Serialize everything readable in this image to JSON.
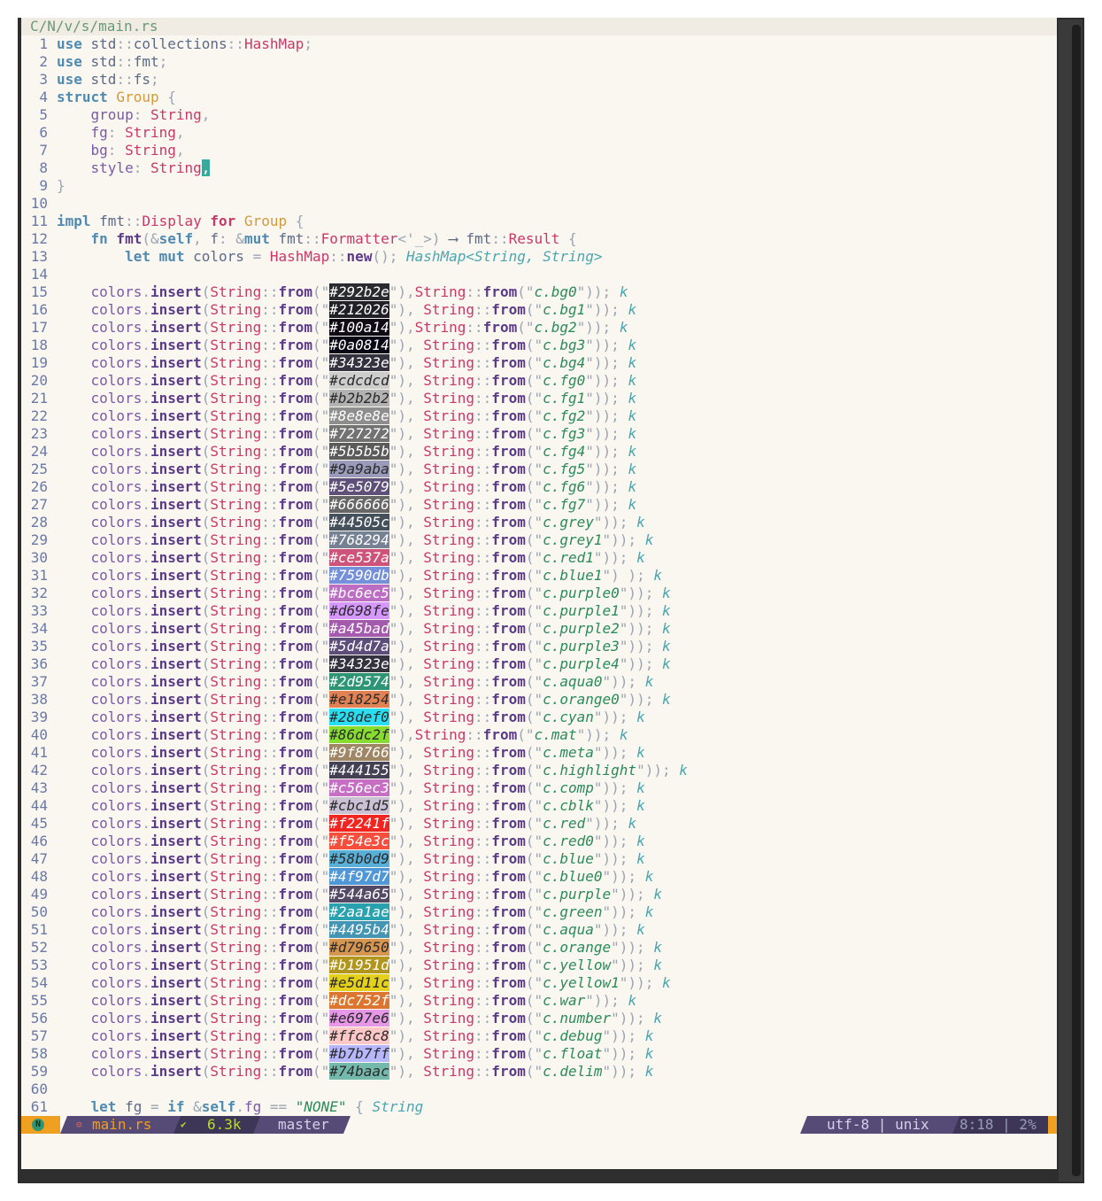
{
  "file_path": "C/N/v/s/main.rs",
  "colors": {
    "editor_bg": "#faf7f0",
    "status_bg": "#564a76",
    "status_fg": "#d8d0e8",
    "status_accent": "#f0a020"
  },
  "code_lines": [
    {
      "n": "1"
    },
    {
      "n": "2"
    },
    {
      "n": "3"
    },
    {
      "n": "4"
    },
    {
      "n": "5"
    },
    {
      "n": "6"
    },
    {
      "n": "7"
    },
    {
      "n": "8"
    },
    {
      "n": "9"
    },
    {
      "n": "10"
    },
    {
      "n": "11"
    },
    {
      "n": "12"
    },
    {
      "n": "13"
    },
    {
      "n": "14"
    }
  ],
  "header_code": [
    [
      [
        "kw",
        "use"
      ],
      [
        "id",
        " std"
      ],
      [
        "pc",
        "::"
      ],
      [
        "id",
        "collections"
      ],
      [
        "pc",
        "::"
      ],
      [
        "ty",
        "HashMap"
      ],
      [
        "pc",
        ";"
      ]
    ],
    [
      [
        "kw",
        "use"
      ],
      [
        "id",
        " std"
      ],
      [
        "pc",
        "::"
      ],
      [
        "id",
        "fmt"
      ],
      [
        "pc",
        ";"
      ]
    ],
    [
      [
        "kw",
        "use"
      ],
      [
        "id",
        " std"
      ],
      [
        "pc",
        "::"
      ],
      [
        "id",
        "fs"
      ],
      [
        "pc",
        ";"
      ]
    ],
    [
      [
        "kw",
        "struct"
      ],
      [
        "ty2",
        " Group"
      ],
      [
        "pc",
        " {"
      ]
    ],
    [
      [
        "fld",
        "    group"
      ],
      [
        "pc",
        ": "
      ],
      [
        "ty",
        "String"
      ],
      [
        "pc",
        ","
      ]
    ],
    [
      [
        "fld",
        "    fg"
      ],
      [
        "pc",
        ": "
      ],
      [
        "ty",
        "String"
      ],
      [
        "pc",
        ","
      ]
    ],
    [
      [
        "fld",
        "    bg"
      ],
      [
        "pc",
        ": "
      ],
      [
        "ty",
        "String"
      ],
      [
        "pc",
        ","
      ]
    ],
    [
      [
        "fld",
        "    style"
      ],
      [
        "pc",
        ": "
      ],
      [
        "ty",
        "String"
      ],
      [
        "cursor",
        ","
      ]
    ],
    [
      [
        "pc",
        "}"
      ]
    ],
    [],
    [
      [
        "kw",
        "impl"
      ],
      [
        "id",
        " fmt"
      ],
      [
        "pc",
        "::"
      ],
      [
        "ty",
        "Display"
      ],
      [
        "kw2",
        " for"
      ],
      [
        "ty2",
        " Group"
      ],
      [
        "pc",
        " {"
      ]
    ],
    [
      [
        "kw",
        "    fn"
      ],
      [
        "fn",
        " fmt"
      ],
      [
        "pc",
        "(&"
      ],
      [
        "kw",
        "self"
      ],
      [
        "pc",
        ", "
      ],
      [
        "id",
        "f"
      ],
      [
        "pc",
        ": &"
      ],
      [
        "kw",
        "mut"
      ],
      [
        "id",
        " fmt"
      ],
      [
        "pc",
        "::"
      ],
      [
        "ty",
        "Formatter"
      ],
      [
        "pc",
        "<'_>) "
      ],
      [
        "id",
        "⟶ "
      ],
      [
        "id",
        "fmt"
      ],
      [
        "pc",
        "::"
      ],
      [
        "ty",
        "Result"
      ],
      [
        "pc",
        " {"
      ]
    ],
    [
      [
        "kw",
        "        let mut"
      ],
      [
        "id",
        " colors"
      ],
      [
        "pc",
        " = "
      ],
      [
        "ty",
        "HashMap"
      ],
      [
        "pc",
        "::"
      ],
      [
        "fn",
        "new"
      ],
      [
        "pc",
        "(); "
      ],
      [
        "cm",
        "HashMap<String, String>"
      ]
    ],
    []
  ],
  "color_entries": [
    {
      "n": "15",
      "hex": "#292b2e",
      "name": "c.bg0",
      "tight": true
    },
    {
      "n": "16",
      "hex": "#212026",
      "name": "c.bg1"
    },
    {
      "n": "17",
      "hex": "#100a14",
      "name": "c.bg2",
      "tight": true
    },
    {
      "n": "18",
      "hex": "#0a0814",
      "name": "c.bg3"
    },
    {
      "n": "19",
      "hex": "#34323e",
      "name": "c.bg4"
    },
    {
      "n": "20",
      "hex": "#cdcdcd",
      "name": "c.fg0"
    },
    {
      "n": "21",
      "hex": "#b2b2b2",
      "name": "c.fg1"
    },
    {
      "n": "22",
      "hex": "#8e8e8e",
      "name": "c.fg2"
    },
    {
      "n": "23",
      "hex": "#727272",
      "name": "c.fg3"
    },
    {
      "n": "24",
      "hex": "#5b5b5b",
      "name": "c.fg4"
    },
    {
      "n": "25",
      "hex": "#9a9aba",
      "name": "c.fg5"
    },
    {
      "n": "26",
      "hex": "#5e5079",
      "name": "c.fg6"
    },
    {
      "n": "27",
      "hex": "#666666",
      "name": "c.fg7"
    },
    {
      "n": "28",
      "hex": "#44505c",
      "name": "c.grey"
    },
    {
      "n": "29",
      "hex": "#768294",
      "name": "c.grey1"
    },
    {
      "n": "30",
      "hex": "#ce537a",
      "name": "c.red1"
    },
    {
      "n": "31",
      "hex": "#7590db",
      "name": "c.blue1",
      "gap": true
    },
    {
      "n": "32",
      "hex": "#bc6ec5",
      "name": "c.purple0"
    },
    {
      "n": "33",
      "hex": "#d698fe",
      "name": "c.purple1"
    },
    {
      "n": "34",
      "hex": "#a45bad",
      "name": "c.purple2"
    },
    {
      "n": "35",
      "hex": "#5d4d7a",
      "name": "c.purple3"
    },
    {
      "n": "36",
      "hex": "#34323e",
      "name": "c.purple4"
    },
    {
      "n": "37",
      "hex": "#2d9574",
      "name": "c.aqua0"
    },
    {
      "n": "38",
      "hex": "#e18254",
      "name": "c.orange0"
    },
    {
      "n": "39",
      "hex": "#28def0",
      "name": "c.cyan"
    },
    {
      "n": "40",
      "hex": "#86dc2f",
      "name": "c.mat",
      "tight": true
    },
    {
      "n": "41",
      "hex": "#9f8766",
      "name": "c.meta"
    },
    {
      "n": "42",
      "hex": "#444155",
      "name": "c.highlight"
    },
    {
      "n": "43",
      "hex": "#c56ec3",
      "name": "c.comp"
    },
    {
      "n": "44",
      "hex": "#cbc1d5",
      "name": "c.cblk"
    },
    {
      "n": "45",
      "hex": "#f2241f",
      "name": "c.red"
    },
    {
      "n": "46",
      "hex": "#f54e3c",
      "name": "c.red0"
    },
    {
      "n": "47",
      "hex": "#58b0d9",
      "name": "c.blue"
    },
    {
      "n": "48",
      "hex": "#4f97d7",
      "name": "c.blue0"
    },
    {
      "n": "49",
      "hex": "#544a65",
      "name": "c.purple"
    },
    {
      "n": "50",
      "hex": "#2aa1ae",
      "name": "c.green"
    },
    {
      "n": "51",
      "hex": "#4495b4",
      "name": "c.aqua"
    },
    {
      "n": "52",
      "hex": "#d79650",
      "name": "c.orange"
    },
    {
      "n": "53",
      "hex": "#b1951d",
      "name": "c.yellow"
    },
    {
      "n": "54",
      "hex": "#e5d11c",
      "name": "c.yellow1"
    },
    {
      "n": "55",
      "hex": "#dc752f",
      "name": "c.war"
    },
    {
      "n": "56",
      "hex": "#e697e6",
      "name": "c.number"
    },
    {
      "n": "57",
      "hex": "#ffc8c8",
      "name": "c.debug"
    },
    {
      "n": "58",
      "hex": "#b7b7ff",
      "name": "c.float"
    },
    {
      "n": "59",
      "hex": "#74baac",
      "name": "c.delim"
    }
  ],
  "trailing_lines": [
    {
      "n": "60",
      "tokens": []
    },
    {
      "n": "61",
      "tokens": [
        [
          "kw",
          "    let"
        ],
        [
          "id",
          " fg"
        ],
        [
          "pc",
          " = "
        ],
        [
          "kw",
          "if"
        ],
        [
          "pc",
          " &"
        ],
        [
          "kw",
          "self"
        ],
        [
          "pc",
          "."
        ],
        [
          "fld",
          "fg"
        ],
        [
          "pc",
          " == "
        ],
        [
          "str",
          "\"NONE\""
        ],
        [
          "pc",
          " { "
        ],
        [
          "cm",
          "String"
        ]
      ]
    }
  ],
  "statusbar": {
    "mode_icon": "N",
    "file_name": "main.rs",
    "file_icon": "rust-icon",
    "size": "6.3k",
    "branch": "master",
    "encoding": "utf-8 | unix",
    "position": "8:18 | 2%"
  }
}
